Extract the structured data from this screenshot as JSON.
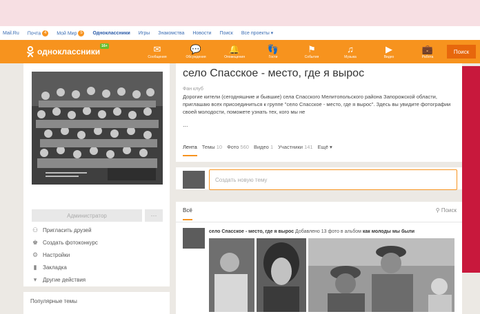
{
  "topnav": {
    "mail": "Mail.Ru",
    "post": "Почта",
    "post_badge": "4",
    "myworld": "Мой Мир",
    "myworld_badge": "5",
    "ok": "Одноклассники",
    "games": "Игры",
    "dating": "Знакомства",
    "news": "Новости",
    "search": "Поиск",
    "all_projects": "Все проекты ▾"
  },
  "header": {
    "logo_text": "одноклассники",
    "beta": "16+",
    "search_button": "Поиск",
    "nav": [
      {
        "label": "Сообщения",
        "icon": "envelope-icon",
        "glyph": "✉"
      },
      {
        "label": "Обсуждения",
        "icon": "chat-icon",
        "glyph": "💬"
      },
      {
        "label": "Оповещения",
        "icon": "bell-icon",
        "glyph": "🔔"
      },
      {
        "label": "Гости",
        "icon": "footprints-icon",
        "glyph": "👣"
      },
      {
        "label": "События",
        "icon": "events-icon",
        "glyph": "⚑"
      },
      {
        "label": "Музыка",
        "icon": "music-icon",
        "glyph": "♫"
      },
      {
        "label": "Видео",
        "icon": "video-icon",
        "glyph": "▶"
      },
      {
        "label": "Работа",
        "icon": "briefcase-icon",
        "glyph": "💼"
      }
    ]
  },
  "sidebar": {
    "admin_button": "Администратор",
    "more_button": "···",
    "actions": [
      {
        "label": "Пригласить друзей",
        "icon": "invite-icon",
        "glyph": "⚇"
      },
      {
        "label": "Создать фотоконкурс",
        "icon": "contest-icon",
        "glyph": "♚"
      },
      {
        "label": "Настройки",
        "icon": "gear-icon",
        "glyph": "⚙"
      },
      {
        "label": "Закладка",
        "icon": "bookmark-icon",
        "glyph": "▮"
      },
      {
        "label": "Другие действия",
        "icon": "chevron-down-icon",
        "glyph": "▾"
      }
    ],
    "popular_topics": "Популярные темы"
  },
  "group": {
    "title": "село Спасское - место, где я вырос",
    "subtitle": "Фан клуб",
    "description": "Дорогие кители (сегодняшние и бывшие) села Спасского Мелитопольского района Запорожской области, приглашаю всех присоединиться к группе \"село Спасское - место, где я вырос\". Здесь вы увидите фотографии своей молодости, поможете узнать тех, кого мы не",
    "ellipsis": "...",
    "tabs": [
      {
        "label": "Лента",
        "count": ""
      },
      {
        "label": "Темы",
        "count": "10"
      },
      {
        "label": "Фото",
        "count": "560"
      },
      {
        "label": "Видео",
        "count": "1"
      },
      {
        "label": "Участники",
        "count": "141"
      },
      {
        "label": "Ещё ▾",
        "count": ""
      }
    ]
  },
  "post": {
    "placeholder": "Создать новую тему"
  },
  "feed": {
    "tab_all": "Всё",
    "search": "Поиск",
    "item": {
      "author": "село Спасское - место, где я вырос",
      "action": "Добавлено 13 фото в альбом",
      "album": "как молоды мы были"
    }
  },
  "colors": {
    "accent": "#f7931e",
    "accent_dark": "#e7670c",
    "link": "#3b6db3"
  }
}
